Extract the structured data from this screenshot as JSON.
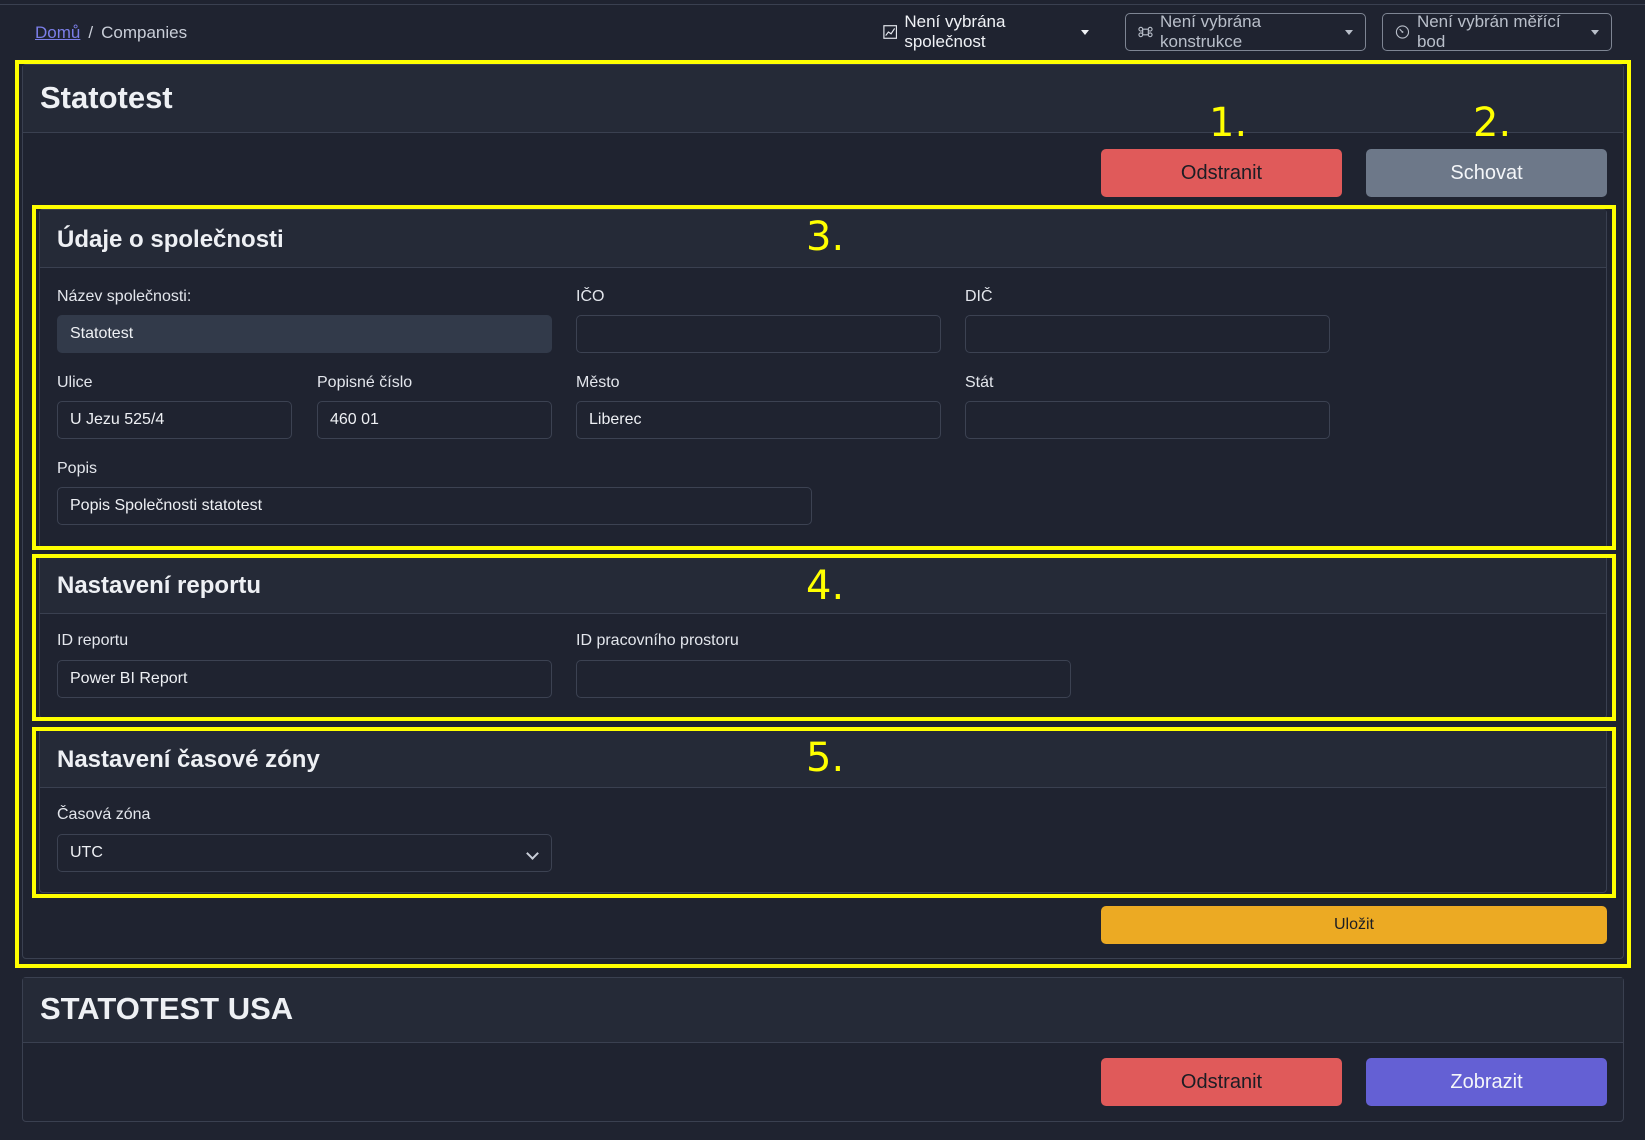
{
  "breadcrumb": {
    "home": "Domů",
    "separator": "/",
    "current": "Companies"
  },
  "selectors": {
    "company": "Není vybrána společnost",
    "construction": "Není vybrána konstrukce",
    "measuring_point": "Není vybrán měřící bod"
  },
  "company1": {
    "title": "Statotest",
    "delete_label": "Odstranit",
    "hide_label": "Schovat",
    "details": {
      "heading": "Údaje o společnosti",
      "name_label": "Název společnosti:",
      "name_value": "Statotest",
      "ico_label": "IČO",
      "ico_value": "",
      "dic_label": "DIČ",
      "dic_value": "",
      "street_label": "Ulice",
      "street_value": "U Jezu 525/4",
      "number_label": "Popisné číslo",
      "number_value": "460 01",
      "city_label": "Město",
      "city_value": "Liberec",
      "country_label": "Stát",
      "country_value": "",
      "description_label": "Popis",
      "description_value": "Popis Společnosti statotest"
    },
    "report": {
      "heading": "Nastavení reportu",
      "report_id_label": "ID reportu",
      "report_id_value": "Power BI Report",
      "workspace_id_label": "ID pracovního prostoru",
      "workspace_id_value": ""
    },
    "timezone": {
      "heading": "Nastavení časové zóny",
      "label": "Časová zóna",
      "value": "UTC"
    },
    "save_label": "Uložit"
  },
  "company2": {
    "title": "STATOTEST USA",
    "delete_label": "Odstranit",
    "show_label": "Zobrazit"
  },
  "annotations": [
    "1.",
    "2.",
    "3.",
    "4.",
    "5."
  ],
  "colors": {
    "background": "#1f2330",
    "danger": "#e05a5a",
    "secondary": "#6d7889",
    "primary": "#6460d4",
    "warning": "#ecaa23",
    "highlight": "#ffff00"
  }
}
